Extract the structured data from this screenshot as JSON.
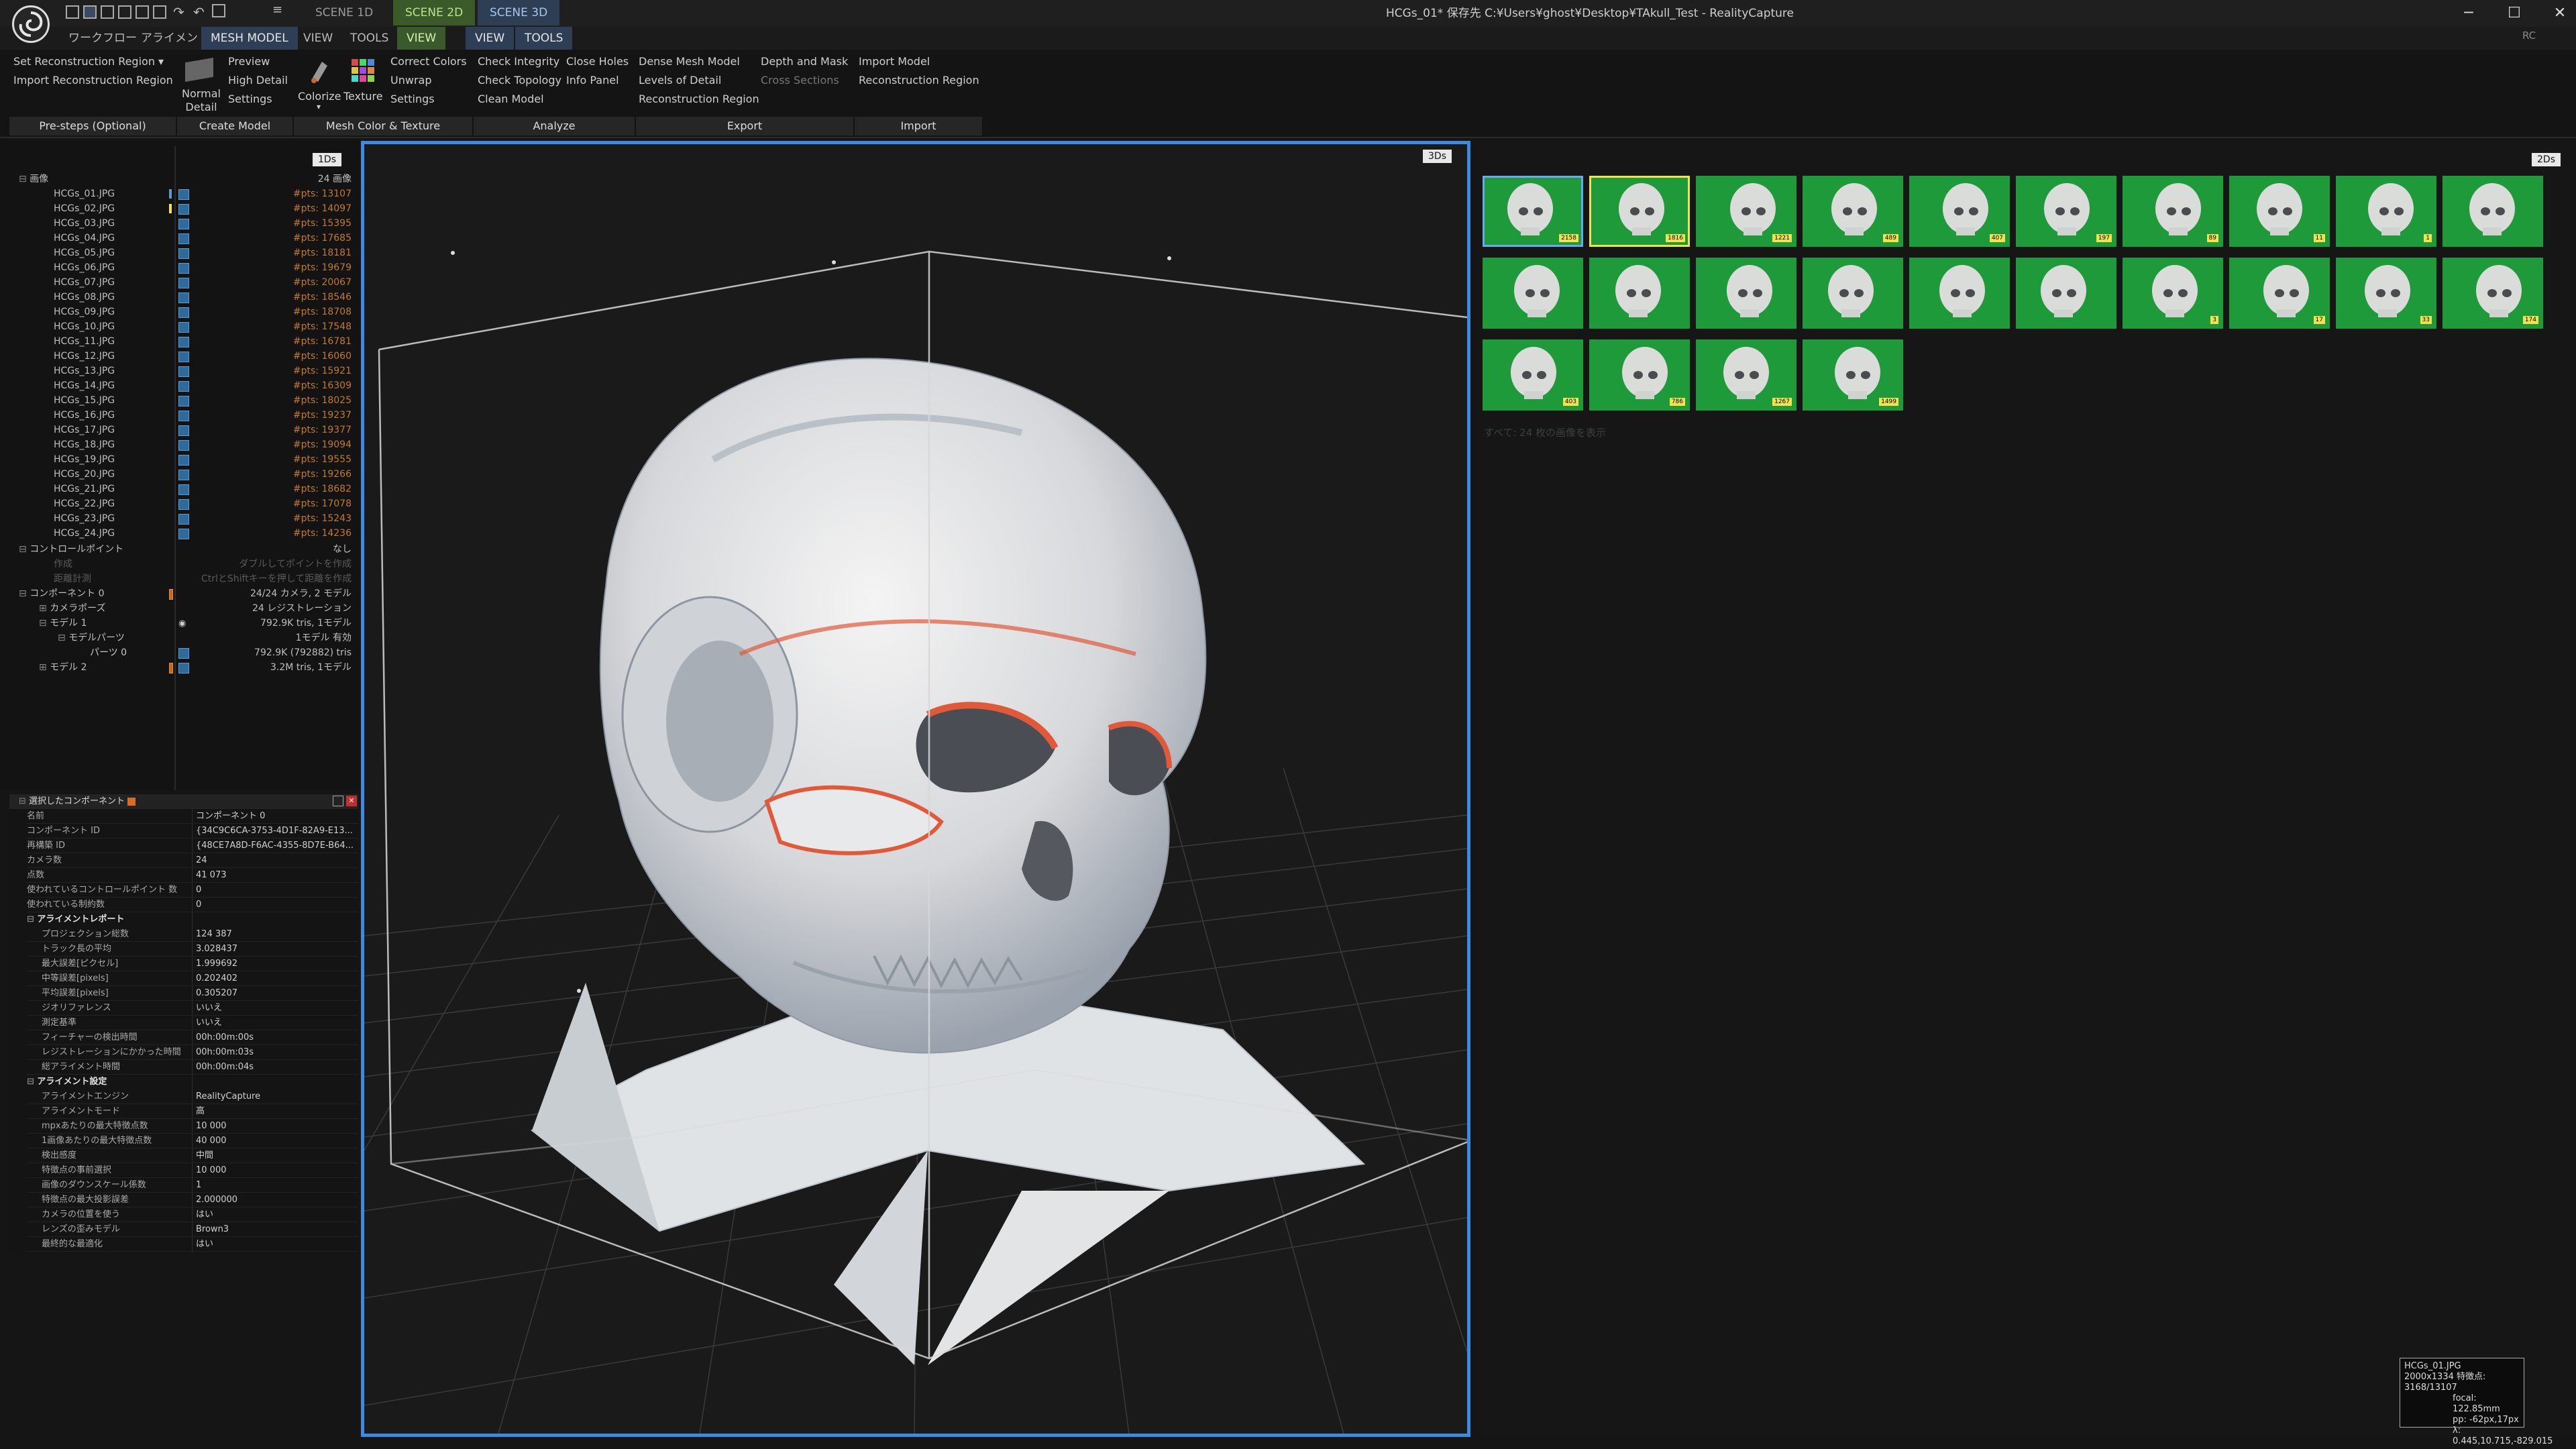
{
  "window": {
    "title": "HCGs_01* 保存先 C:¥Users¥ghost¥Desktop¥TAkull_Test - RealityCapture",
    "scene_tabs": [
      "SCENE 1D",
      "SCENE 2D",
      "SCENE 3D"
    ],
    "controls": {
      "minimize": "─",
      "maximize": "☐",
      "close": "✕"
    },
    "right_indicator": "RC"
  },
  "menu": {
    "workflow": "ワークフロー",
    "alignment": "アライメント",
    "mesh_model": "MESH MODEL",
    "view": "VIEW",
    "tools": "TOOLS",
    "view2": "VIEW",
    "view3": "VIEW",
    "tools3": "TOOLS"
  },
  "ribbon": {
    "presteps": {
      "set_region": "Set Reconstruction Region",
      "import_region": "Import Reconstruction Region",
      "group": "Pre-steps (Optional)"
    },
    "create": {
      "normal_detail": "Normal Detail",
      "preview": "Preview",
      "high_detail": "High Detail",
      "settings": "Settings",
      "group": "Create Model"
    },
    "color": {
      "colorize": "Colorize",
      "texture": "Texture",
      "correct_colors": "Correct Colors",
      "unwrap": "Unwrap",
      "settings": "Settings",
      "group": "Mesh Color & Texture"
    },
    "analyze": {
      "check_integrity": "Check Integrity",
      "check_topology": "Check Topology",
      "clean_model": "Clean Model",
      "close_holes": "Close Holes",
      "info_panel": "Info Panel",
      "group": "Analyze"
    },
    "export": {
      "dense_mesh": "Dense Mesh Model",
      "levels": "Levels of Detail",
      "recon_region": "Reconstruction Region",
      "depth_mask": "Depth and Mask",
      "cross_sections": "Cross Sections",
      "group": "Export"
    },
    "import": {
      "import_model": "Import Model",
      "recon_region": "Reconstruction Region",
      "group": "Import"
    }
  },
  "tree": {
    "badge": "1Ds",
    "images_label": "画像",
    "images_count": "24 画像",
    "images": [
      {
        "name": "HCGs_01.JPG",
        "pts": "#pts: 13107"
      },
      {
        "name": "HCGs_02.JPG",
        "pts": "#pts: 14097"
      },
      {
        "name": "HCGs_03.JPG",
        "pts": "#pts: 15395"
      },
      {
        "name": "HCGs_04.JPG",
        "pts": "#pts: 17685"
      },
      {
        "name": "HCGs_05.JPG",
        "pts": "#pts: 18181"
      },
      {
        "name": "HCGs_06.JPG",
        "pts": "#pts: 19679"
      },
      {
        "name": "HCGs_07.JPG",
        "pts": "#pts: 20067"
      },
      {
        "name": "HCGs_08.JPG",
        "pts": "#pts: 18546"
      },
      {
        "name": "HCGs_09.JPG",
        "pts": "#pts: 18708"
      },
      {
        "name": "HCGs_10.JPG",
        "pts": "#pts: 17548"
      },
      {
        "name": "HCGs_11.JPG",
        "pts": "#pts: 16781"
      },
      {
        "name": "HCGs_12.JPG",
        "pts": "#pts: 16060"
      },
      {
        "name": "HCGs_13.JPG",
        "pts": "#pts: 15921"
      },
      {
        "name": "HCGs_14.JPG",
        "pts": "#pts: 16309"
      },
      {
        "name": "HCGs_15.JPG",
        "pts": "#pts: 18025"
      },
      {
        "name": "HCGs_16.JPG",
        "pts": "#pts: 19237"
      },
      {
        "name": "HCGs_17.JPG",
        "pts": "#pts: 19377"
      },
      {
        "name": "HCGs_18.JPG",
        "pts": "#pts: 19094"
      },
      {
        "name": "HCGs_19.JPG",
        "pts": "#pts: 19555"
      },
      {
        "name": "HCGs_20.JPG",
        "pts": "#pts: 19266"
      },
      {
        "name": "HCGs_21.JPG",
        "pts": "#pts: 18682"
      },
      {
        "name": "HCGs_22.JPG",
        "pts": "#pts: 17078"
      },
      {
        "name": "HCGs_23.JPG",
        "pts": "#pts: 15243"
      },
      {
        "name": "HCGs_24.JPG",
        "pts": "#pts: 14236"
      }
    ],
    "control_points": {
      "label": "コントロールポイント",
      "value": "なし"
    },
    "dim_rows": [
      {
        "name": "作成",
        "value": "ダブルしてポイントを作成"
      },
      {
        "name": "距離計測",
        "value": "CtrlとShiftキーを押して距離を作成"
      }
    ],
    "component": {
      "label": "コンポーネント 0",
      "value": "24/24 カメラ, 2 モデル"
    },
    "camera_poses": {
      "label": "カメラポーズ",
      "value": "24 レジストレーション"
    },
    "model1": {
      "label": "モデル 1",
      "value": "792.9K tris, 1モデル"
    },
    "model_parts": {
      "label": "モデルパーツ",
      "value": "1モデル 有効"
    },
    "part0": {
      "label": "パーツ 0",
      "value": "792.9K (792882) tris"
    },
    "model2": {
      "label": "モデル 2",
      "value": "3.2M tris, 1モデル"
    }
  },
  "props": {
    "header": "選択したコンポーネント",
    "rows": [
      {
        "k": "名前",
        "v": "コンポーネント 0"
      },
      {
        "k": "コンポーネント ID",
        "v": "{34C9C6CA-3753-4D1F-82A9-E13..."
      },
      {
        "k": "再構築 ID",
        "v": "{48CE7A8D-F6AC-4355-8D7E-B64..."
      },
      {
        "k": "カメラ数",
        "v": "24"
      },
      {
        "k": "点数",
        "v": "41 073"
      },
      {
        "k": "使われているコントロールポイント 数",
        "v": "0"
      },
      {
        "k": "使われている制約数",
        "v": "0"
      }
    ],
    "sec1": "アライメントレポート",
    "rows1": [
      {
        "k": "プロジェクション総数",
        "v": "124 387"
      },
      {
        "k": "トラック長の平均",
        "v": "3.028437"
      },
      {
        "k": "最大誤差[ピクセル]",
        "v": "1.999692"
      },
      {
        "k": "中等誤差[pixels]",
        "v": "0.202402"
      },
      {
        "k": "平均誤差[pixels]",
        "v": "0.305207"
      },
      {
        "k": "ジオリファレンス",
        "v": "いいえ"
      },
      {
        "k": "測定基準",
        "v": "いいえ"
      },
      {
        "k": "フィーチャーの検出時間",
        "v": "00h:00m:00s"
      },
      {
        "k": "レジストレーションにかかった時間",
        "v": "00h:00m:03s"
      },
      {
        "k": "総アライメント時間",
        "v": "00h:00m:04s"
      }
    ],
    "sec2": "アライメント設定",
    "rows2": [
      {
        "k": "アライメントエンジン",
        "v": "RealityCapture"
      },
      {
        "k": "アライメントモード",
        "v": "高"
      },
      {
        "k": "mpxあたりの最大特徴点数",
        "v": "10 000"
      },
      {
        "k": "1画像あたりの最大特徴点数",
        "v": "40 000"
      },
      {
        "k": "検出感度",
        "v": "中間"
      },
      {
        "k": "特徴点の事前選択",
        "v": "10 000"
      },
      {
        "k": "画像のダウンスケール係数",
        "v": "1"
      },
      {
        "k": "特徴点の最大投影誤差",
        "v": "2.000000"
      },
      {
        "k": "カメラの位置を使う",
        "v": "はい"
      },
      {
        "k": "レンズの歪みモデル",
        "v": "Brown3"
      },
      {
        "k": "最終的な最適化",
        "v": "はい"
      }
    ]
  },
  "view3d": {
    "badge": "3Ds"
  },
  "panel2d": {
    "badge": "2Ds",
    "thumb_labels": [
      "2158",
      "1816",
      "1221",
      "489",
      "407",
      "197",
      "89",
      "11",
      "1",
      "",
      "",
      "",
      "",
      "",
      "",
      "",
      "3",
      "17",
      "33",
      "174",
      "403",
      "786",
      "1267",
      "1499"
    ],
    "all_images_text": "すべて: 24 枚の画像を表示"
  },
  "info": {
    "name": "HCGs_01.JPG",
    "size": "2000x1334",
    "feat": "特徴点: 3168/13107",
    "focal": "focal: 122.85mm",
    "pp": "pp: -62px,17px",
    "coords": "λ: 0.445,10.715,-829.015"
  }
}
